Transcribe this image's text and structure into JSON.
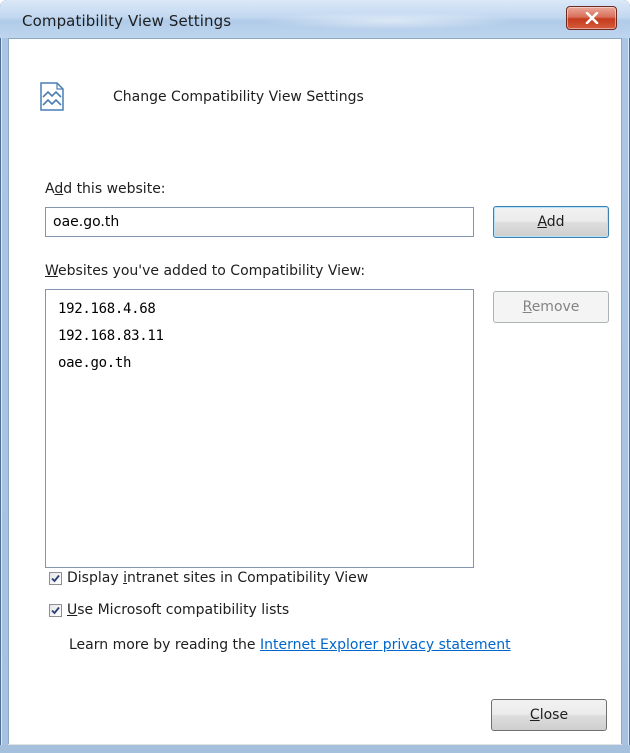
{
  "window": {
    "title": "Compatibility View Settings",
    "close_glyph": "X"
  },
  "header": {
    "icon": "compatibility-view-icon",
    "text": "Change Compatibility View Settings"
  },
  "add_website": {
    "label_pre": "A",
    "label_mnemonic": "d",
    "label_post": "d this website:",
    "value": "oae.go.th",
    "button_mnemonic": "A",
    "button_rest": "dd"
  },
  "websites": {
    "label_mnemonic": "W",
    "label_rest": "ebsites you've added to Compatibility View:",
    "items": [
      "192.168.4.68",
      "192.168.83.11",
      "oae.go.th"
    ],
    "remove_mnemonic": "R",
    "remove_rest": "emove"
  },
  "options": {
    "intranet": {
      "checked": true,
      "pre": "Display ",
      "mnemonic": "i",
      "post": "ntranet sites in Compatibility View"
    },
    "ms_lists": {
      "checked": true,
      "mnemonic": "U",
      "post": "se Microsoft compatibility lists"
    }
  },
  "learn_more": {
    "text": "Learn more by reading the ",
    "link": "Internet Explorer privacy statement"
  },
  "footer": {
    "close_mnemonic": "C",
    "close_rest": "lose"
  },
  "colors": {
    "link": "#0066cc",
    "close_button_red": "#c43b1d",
    "title_bar_blue": "#b0cbe9"
  }
}
